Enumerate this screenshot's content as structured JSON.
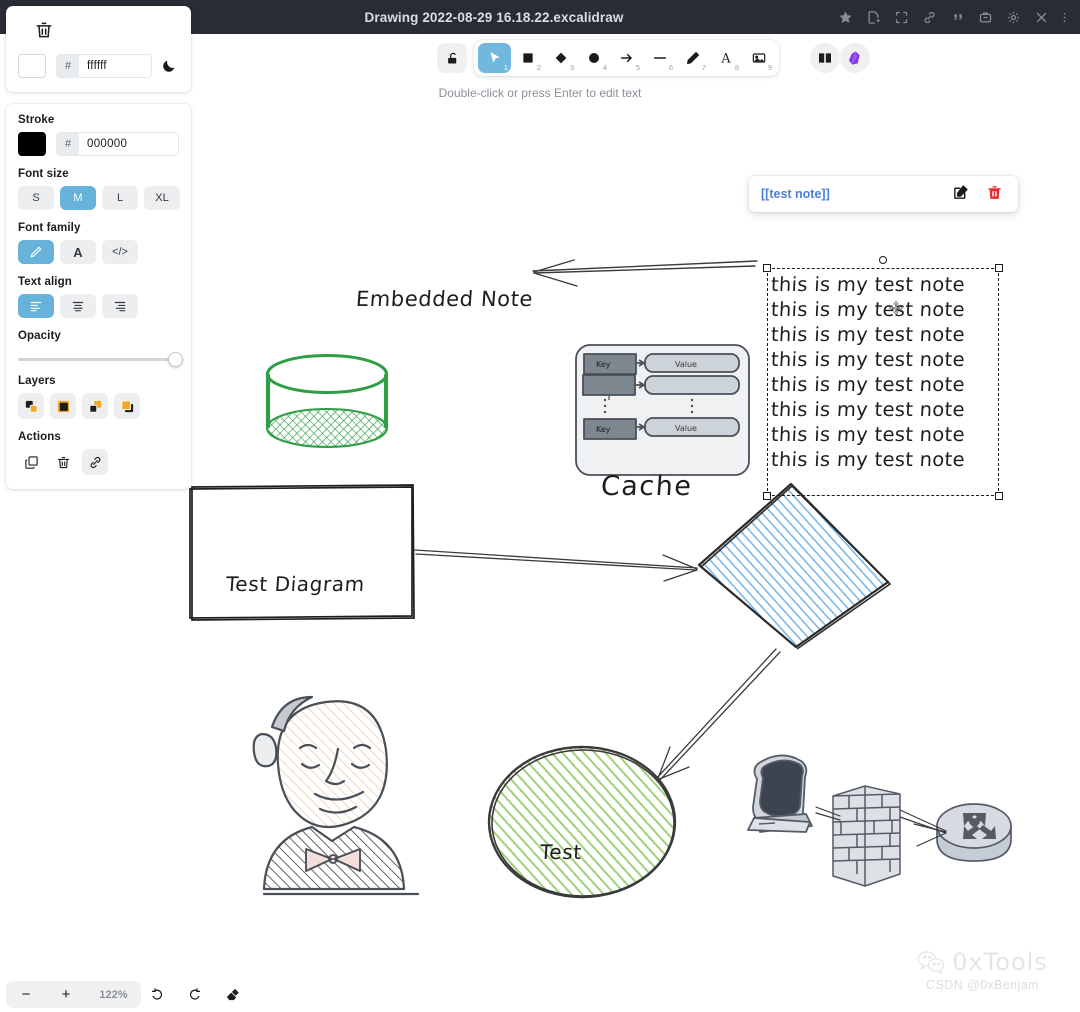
{
  "window": {
    "title": "Drawing 2022-08-29 16.18.22.excalidraw",
    "icons": [
      {
        "name": "star-icon",
        "label": "star"
      },
      {
        "name": "new-note-icon",
        "label": "new note"
      },
      {
        "name": "focus-icon",
        "label": "focus"
      },
      {
        "name": "link-icon",
        "label": "link"
      },
      {
        "name": "quote-icon",
        "label": "quote"
      },
      {
        "name": "archive-icon",
        "label": "archive"
      },
      {
        "name": "gear-icon",
        "label": "settings"
      },
      {
        "name": "close-icon",
        "label": "close"
      },
      {
        "name": "more-icon",
        "label": "more options"
      }
    ]
  },
  "left_panel": {
    "canvas_section": {
      "trash_label": "trash",
      "swatch_color": "#ffffff",
      "hash": "#",
      "hex_value": "ffffff",
      "theme_toggle": "dark mode"
    },
    "stroke": {
      "label": "Stroke",
      "swatch_color": "#000000",
      "hash": "#",
      "hex_value": "000000"
    },
    "font_size": {
      "label": "Font size",
      "options": [
        "S",
        "M",
        "L",
        "XL"
      ],
      "selected": "M"
    },
    "font_family": {
      "label": "Font family",
      "options": [
        "hand-drawn",
        "normal",
        "code"
      ],
      "option_glyphs": [
        "pencil-icon",
        "A",
        "</>"
      ],
      "selected": "hand-drawn"
    },
    "text_align": {
      "label": "Text align",
      "options": [
        "left",
        "center",
        "right"
      ],
      "selected": "left"
    },
    "opacity": {
      "label": "Opacity",
      "value": 100
    },
    "layers": {
      "label": "Layers",
      "options": [
        "send-to-back",
        "send-backward",
        "bring-forward",
        "bring-to-front"
      ]
    },
    "actions": {
      "label": "Actions",
      "options": [
        "duplicate",
        "delete",
        "link"
      ],
      "active": "link"
    }
  },
  "toolbar": {
    "lock_label": "Keep selected tool active after drawing",
    "tools": [
      {
        "name": "selection",
        "num": "1",
        "active": true
      },
      {
        "name": "rectangle",
        "num": "2",
        "active": false
      },
      {
        "name": "diamond",
        "num": "3",
        "active": false
      },
      {
        "name": "ellipse",
        "num": "4",
        "active": false
      },
      {
        "name": "arrow",
        "num": "5",
        "active": false
      },
      {
        "name": "line",
        "num": "6",
        "active": false
      },
      {
        "name": "draw",
        "num": "7",
        "active": false
      },
      {
        "name": "text",
        "num": "8",
        "active": false
      },
      {
        "name": "image",
        "num": "9",
        "active": false
      }
    ],
    "library_label": "Library",
    "obsidian_label": "Obsidian"
  },
  "hint": "Double-click or press Enter to edit text",
  "link_popup": {
    "text": "[[test note]]",
    "edit_label": "Edit link",
    "delete_label": "Remove link",
    "link_color": "#4a7fd4",
    "delete_color": "#e03131"
  },
  "canvas": {
    "selected_text_element": {
      "lines": [
        "this is my test note",
        "this is my test note",
        "this is my test note",
        "this is my test note",
        "this is my test note",
        "this is my test note",
        "this is my test note",
        "this is my test note"
      ]
    },
    "labels": {
      "embedded_note": "Embedded Note",
      "test_diagram": "Test Diagram",
      "cache": "Cache",
      "test": "Test"
    },
    "cache_diagram": {
      "key_label_1": "Key",
      "value_label_1": "Value",
      "key_label_2": "Key",
      "value_label_2": "Value",
      "title": "Cache"
    },
    "shapes": [
      {
        "name": "cylinder",
        "color": "#2f9e44"
      },
      {
        "name": "diamond",
        "color": "#1971c2",
        "fill": "#a5d8ff"
      },
      {
        "name": "ellipse",
        "color": "#1e1e1e",
        "fill": "#b2f2bb"
      },
      {
        "name": "rectangle",
        "color": "#1e1e1e",
        "fill": "transparent"
      },
      {
        "name": "man-sketch",
        "color": "#495057"
      },
      {
        "name": "monitor-icon",
        "color": "#495057"
      },
      {
        "name": "firewall-icon",
        "color": "#495057"
      },
      {
        "name": "router-icon",
        "color": "#495057"
      }
    ]
  },
  "bottom_bar": {
    "zoom_out": "−",
    "zoom_in": "+",
    "zoom_level": "122%",
    "undo_label": "Undo",
    "redo_label": "Redo",
    "eraser_label": "Eraser"
  },
  "watermark": {
    "name": "0xTools",
    "subtitle": "CSDN @0xBenjam"
  }
}
